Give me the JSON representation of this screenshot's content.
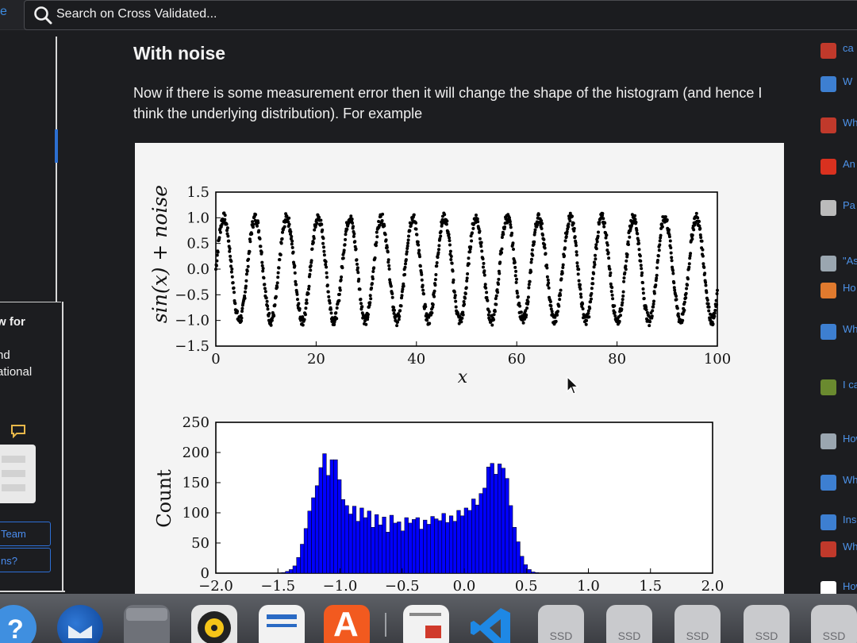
{
  "topbar": {
    "edge_text": "e",
    "search_placeholder": "Search on Cross Validated..."
  },
  "leftcol": {
    "text_for": "w for",
    "text_nd": "nd",
    "text_ational": "ational",
    "btn_team": "Team",
    "btn_ns": "ns?"
  },
  "post": {
    "title": "With noise",
    "body": "Now if there is some measurement error then it will change the shape of the histogram (and hence I think the underlying distribution). For example"
  },
  "chart_data": [
    {
      "type": "scatter",
      "ylabel": "sin(x) + noise",
      "xlabel": "x",
      "xlim": [
        0,
        100
      ],
      "ylim": [
        -1.5,
        1.5
      ],
      "xticks": [
        "0",
        "20",
        "40",
        "60",
        "80",
        "100"
      ],
      "yticks": [
        "1.5",
        "1.0",
        "0.5",
        "0.0",
        "−0.5",
        "−1.0",
        "−1.5"
      ],
      "function": "sin(x) + noise",
      "noise_amplitude": 0.1
    },
    {
      "type": "bar",
      "ylabel": "Count",
      "xlim": [
        -2.0,
        2.0
      ],
      "ylim": [
        0,
        250
      ],
      "xticks": [
        "−2.0",
        "−1.5",
        "−1.0",
        "−0.5",
        "0.0",
        "0.5",
        "1.0",
        "1.5",
        "2.0"
      ],
      "yticks": [
        "250",
        "200",
        "150",
        "100",
        "50",
        "0"
      ],
      "color": "#0000ff",
      "bin_width": 0.03,
      "x_start": -1.5,
      "counts": [
        0,
        1,
        3,
        6,
        12,
        26,
        48,
        74,
        103,
        125,
        145,
        175,
        198,
        162,
        188,
        188,
        155,
        122,
        112,
        98,
        111,
        86,
        108,
        92,
        103,
        76,
        97,
        80,
        93,
        68,
        96,
        83,
        85,
        70,
        92,
        83,
        89,
        92,
        73,
        88,
        81,
        94,
        90,
        87,
        99,
        84,
        95,
        86,
        104,
        95,
        108,
        104,
        123,
        113,
        132,
        141,
        176,
        182,
        164,
        181,
        174,
        157,
        112,
        76,
        52,
        28,
        14,
        6,
        2,
        1
      ]
    }
  ],
  "rightcol": {
    "items": [
      {
        "text": "ca",
        "color": "#c0392b"
      },
      {
        "text": "W",
        "color": "#3d7fd1"
      },
      {
        "text": "Wh",
        "color": "#c0392b"
      },
      {
        "text": "An",
        "color": "#d9311f"
      },
      {
        "text": "Pa",
        "color": "#bbbbbb"
      },
      {
        "text": "\"As",
        "color": "#9aa6b0"
      },
      {
        "text": "Ho",
        "color": "#e07a2e"
      },
      {
        "text": "Wh",
        "color": "#3d7fd1"
      },
      {
        "text": "I ca",
        "color": "#6a8a2f"
      },
      {
        "text": "How",
        "color": "#9aa6b0"
      },
      {
        "text": "Wha",
        "color": "#3d7fd1"
      },
      {
        "text": "Insc",
        "color": "#3d7fd1"
      },
      {
        "text": "Wha",
        "color": "#c0392b"
      },
      {
        "text": "How",
        "color": "#ffffff"
      }
    ]
  },
  "dock": {
    "ssd_label": "SSD",
    "apps": [
      "help",
      "thunderbird",
      "files",
      "rhythmbox",
      "writer",
      "software",
      "news",
      "vscode",
      "ssd",
      "ssd",
      "ssd",
      "ssd",
      "ssd"
    ]
  }
}
